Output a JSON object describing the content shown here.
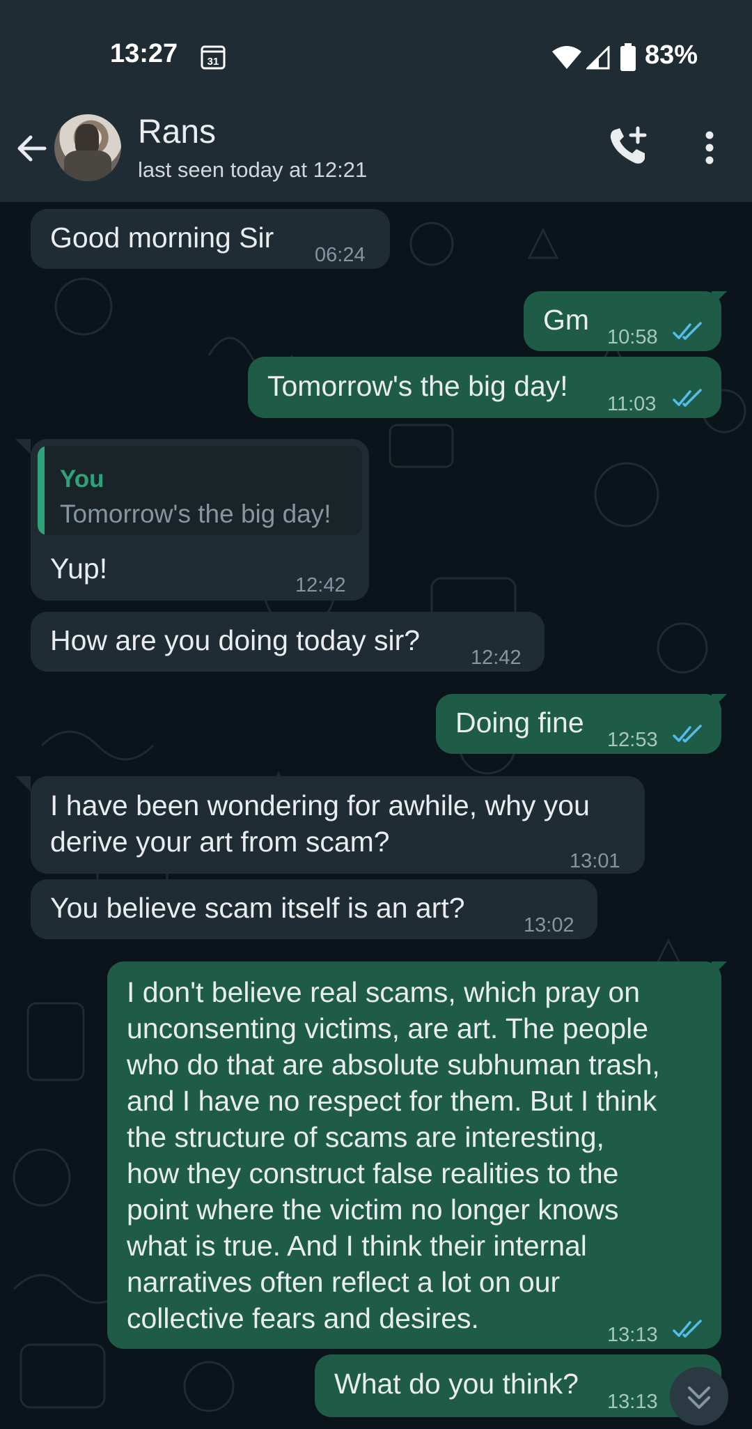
{
  "status_bar": {
    "time": "13:27",
    "calendar_day": "31",
    "battery": "83%"
  },
  "header": {
    "contact_name": "Rans",
    "last_seen": "last seen today at 12:21"
  },
  "messages": [
    {
      "direction": "in",
      "text": "Good morning Sir",
      "time": "06:24"
    },
    {
      "direction": "out",
      "text": "Gm",
      "time": "10:58",
      "status": "read"
    },
    {
      "direction": "out",
      "text": "Tomorrow's the big day!",
      "time": "11:03",
      "status": "read"
    },
    {
      "direction": "in",
      "reply_author": "You",
      "reply_text": "Tomorrow's the big day!",
      "text": "Yup!",
      "time": "12:42"
    },
    {
      "direction": "in",
      "text": "How are you doing today sir?",
      "time": "12:42"
    },
    {
      "direction": "out",
      "text": "Doing fine",
      "time": "12:53",
      "status": "read"
    },
    {
      "direction": "in",
      "lines": [
        "I have been wondering for awhile, why you",
        "derive your art from scam?"
      ],
      "time": "13:01"
    },
    {
      "direction": "in",
      "text": "You believe scam itself is an art?",
      "time": "13:02"
    },
    {
      "direction": "out",
      "lines": [
        "I don't believe real scams, which pray on",
        "unconsenting victims, are art. The people",
        "who do that are absolute subhuman trash,",
        "and I have no respect for them. But I think",
        "the structure of scams are interesting,",
        "how they construct false realities to the",
        "point where the victim no longer knows",
        "what is true. And I think their internal",
        "narratives often reflect a lot on our",
        "collective fears and desires."
      ],
      "time": "13:13",
      "status": "read"
    },
    {
      "direction": "out",
      "text": "What do you think?",
      "time": "13:13",
      "status": "read"
    }
  ],
  "colors": {
    "header_bg": "#202c33",
    "chat_bg": "#0b141a",
    "incoming_bubble": "#202c33",
    "outgoing_bubble": "#1f5c47",
    "read_ticks": "#53bdeb",
    "reply_accent": "#2ea37a"
  },
  "icons": [
    "calendar-icon",
    "wifi-icon",
    "signal-icon",
    "battery-icon",
    "back-arrow-icon",
    "add-call-icon",
    "more-options-icon",
    "double-check-icon",
    "scroll-down-icon"
  ]
}
